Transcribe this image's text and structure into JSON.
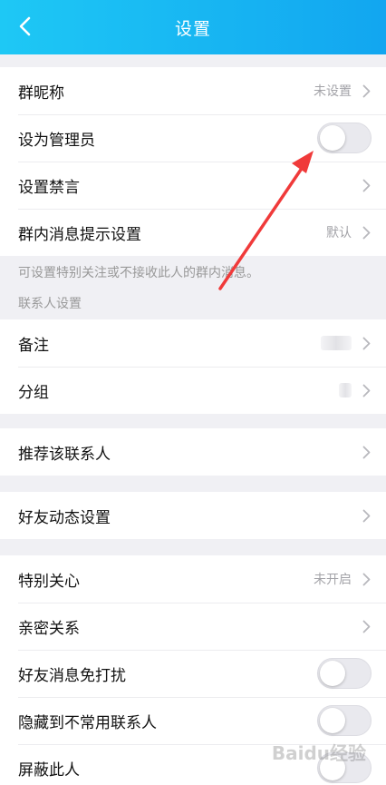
{
  "header": {
    "title": "设置"
  },
  "group1": {
    "rows": [
      {
        "label": "群昵称",
        "value": "未设置"
      },
      {
        "label": "设为管理员",
        "toggle": false
      },
      {
        "label": "设置禁言"
      },
      {
        "label": "群内消息提示设置",
        "value": "默认"
      }
    ]
  },
  "note_text": "可设置特别关注或不接收此人的群内消息。",
  "contacts_section": {
    "title": "联系人设置",
    "rows": [
      {
        "label": "备注"
      },
      {
        "label": "分组"
      }
    ]
  },
  "group3": {
    "rows": [
      {
        "label": "推荐该联系人"
      }
    ]
  },
  "group4": {
    "rows": [
      {
        "label": "好友动态设置"
      }
    ]
  },
  "group5": {
    "rows": [
      {
        "label": "特别关心",
        "value": "未开启"
      },
      {
        "label": "亲密关系"
      },
      {
        "label": "好友消息免打扰",
        "toggle": false
      },
      {
        "label": "隐藏到不常用联系人",
        "toggle": false
      },
      {
        "label": "屏蔽此人",
        "toggle": false
      }
    ]
  },
  "colors": {
    "header_start": "#1ec8f5",
    "header_end": "#12a6f0",
    "annotation_arrow": "#f03a3a"
  },
  "watermark": "Baidu经验"
}
